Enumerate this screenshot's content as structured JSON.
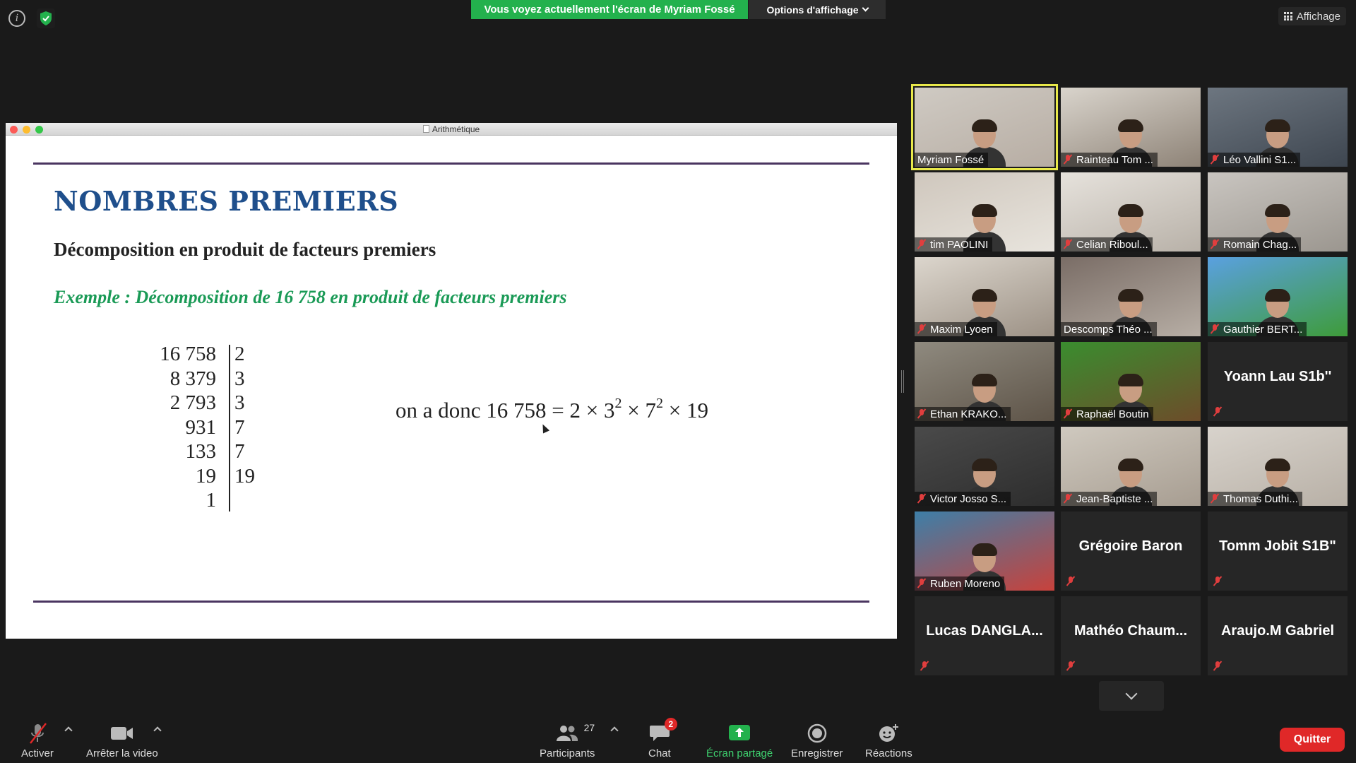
{
  "banner": {
    "sharing_text": "Vous voyez actuellement l'écran de Myriam Fossé",
    "view_options": "Options d'affichage",
    "view_mode": "Affichage"
  },
  "shared_window": {
    "title": "Arithmétique",
    "slide": {
      "title": "NOMBRES PREMIERS",
      "subtitle": "Décomposition en produit de facteurs premiers",
      "example": "Exemple : Décomposition de 16 758 en produit de facteurs premiers",
      "division_rows": [
        {
          "dividend": "16 758",
          "divisor": "2"
        },
        {
          "dividend": "8 379",
          "divisor": "3"
        },
        {
          "dividend": "2 793",
          "divisor": "3"
        },
        {
          "dividend": "931",
          "divisor": "7"
        },
        {
          "dividend": "133",
          "divisor": "7"
        },
        {
          "dividend": "19",
          "divisor": "19"
        },
        {
          "dividend": "1",
          "divisor": ""
        }
      ],
      "result_prefix": "on a donc 16 758 = 2 × 3",
      "result_exp1": "2",
      "result_mid": " × 7",
      "result_exp2": "2",
      "result_suffix": " × 19"
    }
  },
  "participants_gallery": [
    {
      "name": "Myriam Fossé",
      "muted": false,
      "video": true,
      "active": true
    },
    {
      "name": "Rainteau Tom ...",
      "muted": true,
      "video": true
    },
    {
      "name": "Léo Vallini S1...",
      "muted": true,
      "video": true
    },
    {
      "name": "tim PAOLINI",
      "muted": true,
      "video": true
    },
    {
      "name": "Celian Riboul...",
      "muted": true,
      "video": true
    },
    {
      "name": "Romain Chag...",
      "muted": true,
      "video": true
    },
    {
      "name": "Maxim Lyoen",
      "muted": true,
      "video": true
    },
    {
      "name": "Descomps Théo ...",
      "muted": false,
      "video": true
    },
    {
      "name": "Gauthier BERT...",
      "muted": true,
      "video": true
    },
    {
      "name": "Ethan KRAKO...",
      "muted": true,
      "video": true
    },
    {
      "name": "Raphaël Boutin",
      "muted": true,
      "video": true
    },
    {
      "name": "Yoann Lau S1b''",
      "muted": true,
      "video": false
    },
    {
      "name": "Victor Josso S...",
      "muted": true,
      "video": true
    },
    {
      "name": "Jean-Baptiste ...",
      "muted": true,
      "video": true
    },
    {
      "name": "Thomas Duthi...",
      "muted": true,
      "video": true
    },
    {
      "name": "Ruben Moreno",
      "muted": true,
      "video": true
    },
    {
      "name": "Grégoire Baron",
      "muted": true,
      "video": false
    },
    {
      "name": "Tomm Jobit S1B\"",
      "muted": true,
      "video": false
    },
    {
      "name": "Lucas  DANGLA...",
      "muted": true,
      "video": false
    },
    {
      "name": "Mathéo  Chaum...",
      "muted": true,
      "video": false
    },
    {
      "name": "Araujo.M Gabriel",
      "muted": true,
      "video": false
    }
  ],
  "toolbar": {
    "unmute_label": "Activer",
    "stop_video_label": "Arrêter la video",
    "participants_label": "Participants",
    "participants_count": "27",
    "chat_label": "Chat",
    "chat_badge": "2",
    "share_label": "Écran partagé",
    "record_label": "Enregistrer",
    "reactions_label": "Réactions",
    "quit_label": "Quitter"
  },
  "colors": {
    "banner_green": "#23b14d",
    "slide_title_blue": "#1f4f8c",
    "example_green": "#1a9a56",
    "mute_red": "#e03e3e",
    "quit_red": "#e02828",
    "active_speaker_yellow": "#e8e84a"
  }
}
